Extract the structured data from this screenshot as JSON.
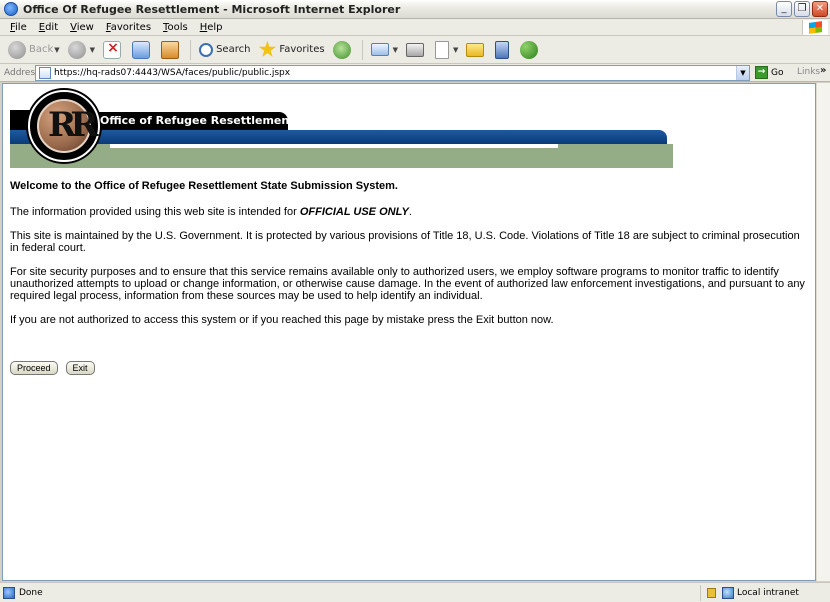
{
  "window": {
    "title": "Office Of Refugee Resettlement - Microsoft Internet Explorer",
    "minimize": "_",
    "maximize": "❐",
    "close": "✕"
  },
  "menu": [
    "File",
    "Edit",
    "View",
    "Favorites",
    "Tools",
    "Help"
  ],
  "toolbar": {
    "back_label": "Back",
    "search_label": "Search",
    "favorites_label": "Favorites"
  },
  "address": {
    "label": "Address",
    "url": "https://hq-rads07:4443/WSA/faces/public/public.jspx",
    "go_label": "Go",
    "links_label": "Links"
  },
  "banner": {
    "title": "Office of Refugee Resettlement",
    "logo_letters": "RR"
  },
  "page": {
    "welcome": "Welcome to the Office of Refugee Resettlement State Submission System.",
    "intended_prefix": "The information provided using this web site is intended for ",
    "official_use": "OFFICIAL USE ONLY",
    "intended_suffix": ".",
    "maintained": "This site is maintained by the U.S. Government. It is protected by various provisions of Title 18, U.S. Code. Violations of Title 18 are subject to criminal prosecution in federal court.",
    "security": "For site security purposes and to ensure that this service remains available only to authorized users, we employ software programs to monitor traffic to identify unauthorized attempts to upload or change information, or otherwise cause damage. In the event of authorized law enforcement investigations, and pursuant to any required legal process, information from these sources may be used to help identify an individual.",
    "not_authorized": "If you are not authorized to access this system or if you reached this page by mistake press the Exit button now.",
    "proceed_label": "Proceed",
    "exit_label": "Exit"
  },
  "status": {
    "text": "Done",
    "zone": "Local intranet"
  }
}
